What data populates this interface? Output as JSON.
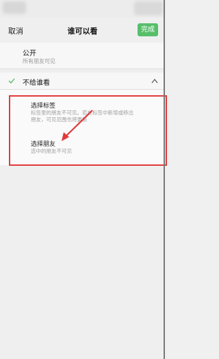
{
  "nav": {
    "cancel_label": "取消",
    "title": "谁可以看",
    "done_label": "完成"
  },
  "options": {
    "public": {
      "title": "公开",
      "subtitle": "所有朋友可见"
    },
    "hide": {
      "title": "不给谁看"
    }
  },
  "hide_sub_options": {
    "by_tag": {
      "title": "选择标签",
      "desc_1": "标签里的朋友不可见。若在标签中新增或移出",
      "desc_2": "朋友，可见范围也将更新"
    },
    "by_friend": {
      "title": "选择朋友",
      "desc": "选中的朋友不可见"
    }
  },
  "colors": {
    "accent_green": "#57be6a",
    "annotation_red": "#e03a3a"
  }
}
